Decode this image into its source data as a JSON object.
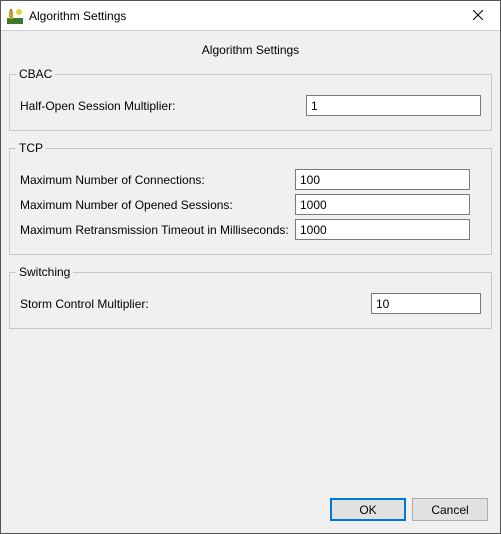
{
  "window": {
    "title": "Algorithm Settings",
    "close_label": "Close"
  },
  "heading": "Algorithm Settings",
  "groups": {
    "cbac": {
      "legend": "CBAC",
      "half_open_label": "Half-Open Session Multiplier:",
      "half_open_value": "1"
    },
    "tcp": {
      "legend": "TCP",
      "max_conn_label": "Maximum Number of Connections:",
      "max_conn_value": "100",
      "max_sess_label": "Maximum Number of Opened Sessions:",
      "max_sess_value": "1000",
      "max_rto_label": "Maximum Retransmission Timeout in Milliseconds:",
      "max_rto_value": "1000"
    },
    "switching": {
      "legend": "Switching",
      "storm_label": "Storm Control Multiplier:",
      "storm_value": "10"
    }
  },
  "buttons": {
    "ok": "OK",
    "cancel": "Cancel"
  }
}
